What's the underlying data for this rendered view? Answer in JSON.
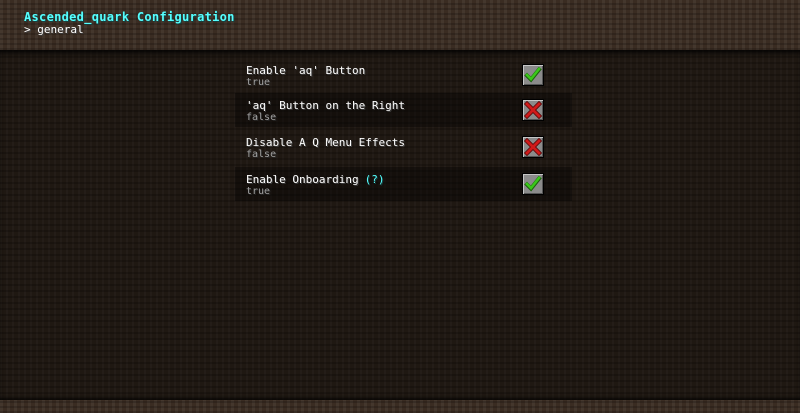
{
  "window": {
    "title": "Ascended_quark Configuration",
    "breadcrumb": "> general"
  },
  "settings": [
    {
      "name": "Enable 'aq' Button",
      "value": "true",
      "icon": "check-icon"
    },
    {
      "name": "'aq' Button on the Right",
      "value": "false",
      "icon": "cross-icon"
    },
    {
      "name": "Disable A Q Menu Effects",
      "value": "false",
      "icon": "cross-icon"
    },
    {
      "name": "Enable Onboarding",
      "help": "(?)",
      "value": "true",
      "icon": "check-icon"
    }
  ],
  "colors": {
    "title": "#55ffff",
    "help": "#55ffff",
    "check": "#3ac71a",
    "cross": "#d11a1a"
  }
}
